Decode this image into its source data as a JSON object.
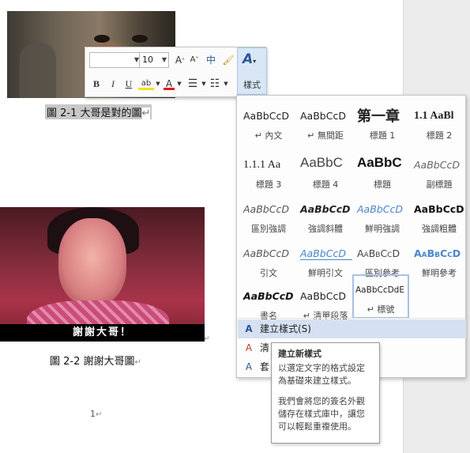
{
  "document": {
    "caption1_label": "圖 2-1",
    "caption1_text": "大哥是對的圖",
    "paragraph_mark": "↵",
    "subtitle_on_image2": "謝謝大哥！",
    "caption2_label": "圖 2-2",
    "caption2_text": "謝謝大哥圖",
    "page_number": "1"
  },
  "mini_toolbar": {
    "font_name": "",
    "font_size": "10",
    "grow_font": "A",
    "shrink_font": "A",
    "phonetic": "中",
    "bold": "B",
    "italic": "I",
    "underline": "U",
    "highlight": "ab",
    "font_color": "A",
    "styles_label": "樣式",
    "highlight_color": "#f5e11b",
    "font_color_value": "#e01b1b"
  },
  "styles_gallery": {
    "tiles": [
      {
        "preview": "AaBbCcD",
        "name": "↵ 內文"
      },
      {
        "preview": "AaBbCcD",
        "name": "↵ 無間距"
      },
      {
        "preview": "第一章",
        "name": "標題 1"
      },
      {
        "preview": "1.1 AaBl",
        "name": "標題 2"
      },
      {
        "preview": "1.1.1 Aa",
        "name": "標題 3"
      },
      {
        "preview": "AaBbC",
        "name": "標題 4"
      },
      {
        "preview": "AaBbC",
        "name": "標題"
      },
      {
        "preview": "AaBbCcD",
        "name": "副標題"
      },
      {
        "preview": "AaBbCcD",
        "name": "區別強調"
      },
      {
        "preview": "AaBbCcD",
        "name": "強調斜體"
      },
      {
        "preview": "AaBbCcD",
        "name": "鮮明強調"
      },
      {
        "preview": "AaBbCcD",
        "name": "強調粗體"
      },
      {
        "preview": "AaBbCcD",
        "name": "引文"
      },
      {
        "preview": "AaBbCcD",
        "name": "鮮明引文"
      },
      {
        "preview": "AaBbCcD",
        "name": "區別參考"
      },
      {
        "preview": "AaBbCcD",
        "name": "鮮明參考"
      },
      {
        "preview": "AaBbCcD",
        "name": "書名"
      },
      {
        "preview": "AaBbCcD",
        "name": "↵ 清單段落"
      },
      {
        "preview": "AaBbCcDdE",
        "name": "↵ 標號"
      }
    ],
    "menu": {
      "create_style": "建立樣式(S)",
      "clear_format": "清",
      "apply_styles": "套"
    }
  },
  "tooltip": {
    "title": "建立新樣式",
    "line1": "以選定文字的格式設定為基礎來建立樣式。",
    "line2": "我們會將您的簽名外觀儲存在樣式庫中，讓您可以輕鬆重複使用。"
  }
}
